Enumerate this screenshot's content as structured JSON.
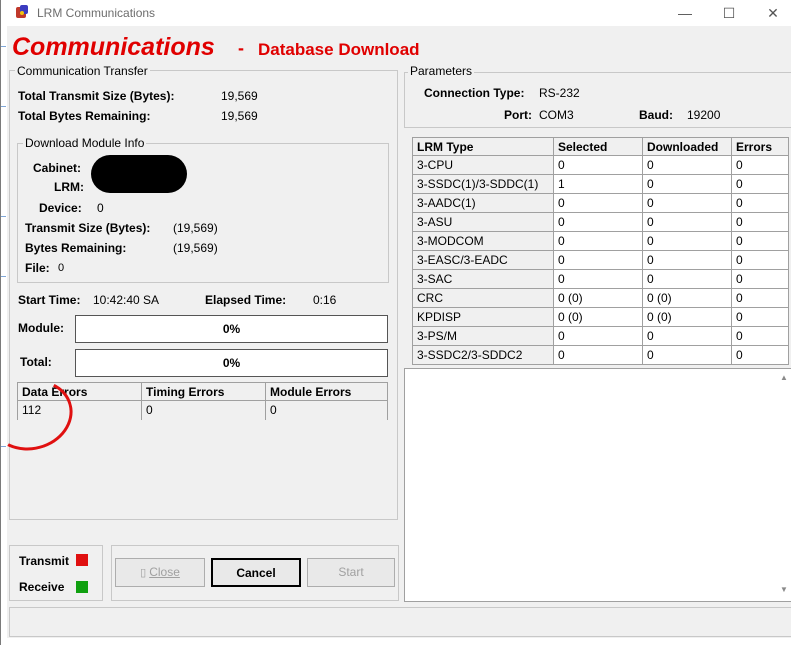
{
  "window": {
    "title": "LRM Communications",
    "minimize": "—",
    "maximize": "☐",
    "close": "✕"
  },
  "heading": {
    "main": "Communications",
    "separator": "-",
    "sub": "Database Download"
  },
  "transfer": {
    "label": "Communication Transfer",
    "total_transmit_label": "Total Transmit Size (Bytes):",
    "total_transmit_value": "19,569",
    "total_remaining_label": "Total Bytes Remaining:",
    "total_remaining_value": "19,569"
  },
  "module_info": {
    "label": "Download Module Info",
    "cabinet_label": "Cabinet:",
    "lrm_label": "LRM:",
    "device_label": "Device:",
    "device_value": "0",
    "transmit_size_label": "Transmit Size (Bytes):",
    "transmit_size_value": "(19,569)",
    "bytes_remaining_label": "Bytes Remaining:",
    "bytes_remaining_value": "(19,569)",
    "file_label": "File:",
    "file_value": "0"
  },
  "timing": {
    "start_label": "Start Time:",
    "start_value": "10:42:40 SA",
    "elapsed_label": "Elapsed Time:",
    "elapsed_value": "0:16"
  },
  "progress": {
    "module_label": "Module:",
    "module_text": "0%",
    "module_fraction": 0,
    "total_label": "Total:",
    "total_text": "0%",
    "total_fraction": 0
  },
  "errors": {
    "headers": [
      "Data Errors",
      "Timing Errors",
      "Module Errors"
    ],
    "values": [
      "112",
      "0",
      "0"
    ]
  },
  "parameters": {
    "label": "Parameters",
    "connection_type_label": "Connection Type:",
    "connection_type_value": "RS-232",
    "port_label": "Port:",
    "port_value": "COM3",
    "baud_label": "Baud:",
    "baud_value": "19200"
  },
  "lrm_table": {
    "headers": [
      "LRM Type",
      "Selected",
      "Downloaded",
      "Errors"
    ],
    "rows": [
      [
        "3-CPU",
        "0",
        "0",
        "0"
      ],
      [
        "3-SSDC(1)/3-SDDC(1)",
        "1",
        "0",
        "0"
      ],
      [
        "3-AADC(1)",
        "0",
        "0",
        "0"
      ],
      [
        "3-ASU",
        "0",
        "0",
        "0"
      ],
      [
        "3-MODCOM",
        "0",
        "0",
        "0"
      ],
      [
        "3-EASC/3-EADC",
        "0",
        "0",
        "0"
      ],
      [
        "3-SAC",
        "0",
        "0",
        "0"
      ],
      [
        "CRC",
        "0 (0)",
        "0 (0)",
        "0"
      ],
      [
        "KPDISP",
        "0 (0)",
        "0 (0)",
        "0"
      ],
      [
        "3-PS/M",
        "0",
        "0",
        "0"
      ],
      [
        "3-SSDC2/3-SDDC2",
        "0",
        "0",
        "0"
      ]
    ]
  },
  "indicators": {
    "transmit_label": "Transmit",
    "transmit_color": "#e01010",
    "receive_label": "Receive",
    "receive_color": "#10a010"
  },
  "buttons": {
    "close_label": "Close",
    "cancel_label": "Cancel",
    "start_label": "Start"
  },
  "colors": {
    "heading": "#e00000",
    "annotation_circle": "#e01010"
  }
}
